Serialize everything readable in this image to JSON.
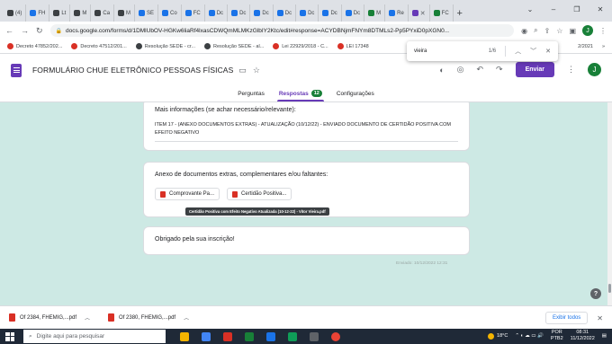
{
  "browser": {
    "tabs": [
      {
        "label": "(4)",
        "color": "#3c4043"
      },
      {
        "label": "FH",
        "color": "#1a73e8"
      },
      {
        "label": "Lt",
        "color": "#3c4043"
      },
      {
        "label": "M",
        "color": "#3c4043"
      },
      {
        "label": "Ca",
        "color": "#3c4043"
      },
      {
        "label": "M",
        "color": "#3c4043"
      },
      {
        "label": "SE",
        "color": "#1a73e8"
      },
      {
        "label": "Co",
        "color": "#1a73e8"
      },
      {
        "label": "FC",
        "color": "#1a73e8"
      },
      {
        "label": "Dc",
        "color": "#1a73e8"
      },
      {
        "label": "Dc",
        "color": "#1a73e8"
      },
      {
        "label": "Dc",
        "color": "#1a73e8"
      },
      {
        "label": "Dc",
        "color": "#1a73e8"
      },
      {
        "label": "Dc",
        "color": "#1a73e8"
      },
      {
        "label": "Dc",
        "color": "#1a73e8"
      },
      {
        "label": "Dc",
        "color": "#1a73e8"
      },
      {
        "label": "M",
        "color": "#188038"
      },
      {
        "label": "Re",
        "color": "#1a73e8"
      }
    ],
    "active_tab_label": "",
    "last_tab": {
      "label": "FC"
    },
    "new_tab_label": "+",
    "window_controls": [
      "⌄",
      "–",
      "❐",
      "✕"
    ],
    "address": "docs.google.com/forms/d/1DMlUbOV-HGKw6liaRf4lxasCDWQmMLMKzGlbIY2Ktc/edit#response=ACYDBNjmFNYm8DTMLs2-Pp5PYxiD0pXGN0...",
    "bookmarks": [
      {
        "label": "Decreto 47852/202...",
        "color": "#d93025"
      },
      {
        "label": "Decreto 47512/201...",
        "color": "#d93025"
      },
      {
        "label": "Resolução SEDE - cr...",
        "color": "#3c4043"
      },
      {
        "label": "Resolução SEDE - al...",
        "color": "#3c4043"
      },
      {
        "label": "Lei 22929/2018 - C...",
        "color": "#d93025"
      },
      {
        "label": "LEI 17348",
        "color": "#d93025"
      }
    ],
    "bookmarks_tail": "2/2021",
    "find": {
      "query": "vieira",
      "count": "1/6"
    }
  },
  "form": {
    "title": "FORMULÁRIO CHUE ELETRÔNICO PESSOAS FÍSICAS",
    "send_label": "Enviar",
    "avatar_initial": "J",
    "tabs": {
      "questions": "Perguntas",
      "responses": "Respostas",
      "responses_count": "12",
      "settings": "Configurações"
    },
    "card1": {
      "question": "Mais informações (se achar necessário/relevante):",
      "answer": "Item 17 - (ANEXO DOCUMENTOS EXTRAS) - ATUALIZAÇÃO (10/12/22) - ENVIADO DOCUMENTO DE CERTIDÃO POSITIVA COM EFEITO NEGATIVO"
    },
    "card2": {
      "question": "Anexo de documentos extras, complementares e/ou faltantes:",
      "files": [
        "Comprovante Pa...",
        "Certidão Positiva..."
      ],
      "tooltip": "Certidão Positiva com Efeito Negativo Atualizada (10-12-22) - Vitor Vieira.pdf"
    },
    "card3": {
      "text": "Obrigado pela sua inscrição!"
    },
    "timestamp": "Enviado: 10/12/2022 12:31",
    "help_label": "?"
  },
  "downloads": {
    "items": [
      "Of 2384, FHEMIG,...pdf",
      "Of 2380, FHEMIG,...pdf"
    ],
    "show_all": "Exibir todos",
    "close": "✕"
  },
  "taskbar": {
    "search_placeholder": "Digite aqui para pesquisar",
    "weather": "18°C",
    "lang": "POR",
    "lang2": "PTB2",
    "time": "08:31",
    "date": "11/12/2022"
  },
  "colors": {
    "accent": "#673ab7",
    "content_bg": "#cde9e4",
    "badge": "#188038"
  }
}
